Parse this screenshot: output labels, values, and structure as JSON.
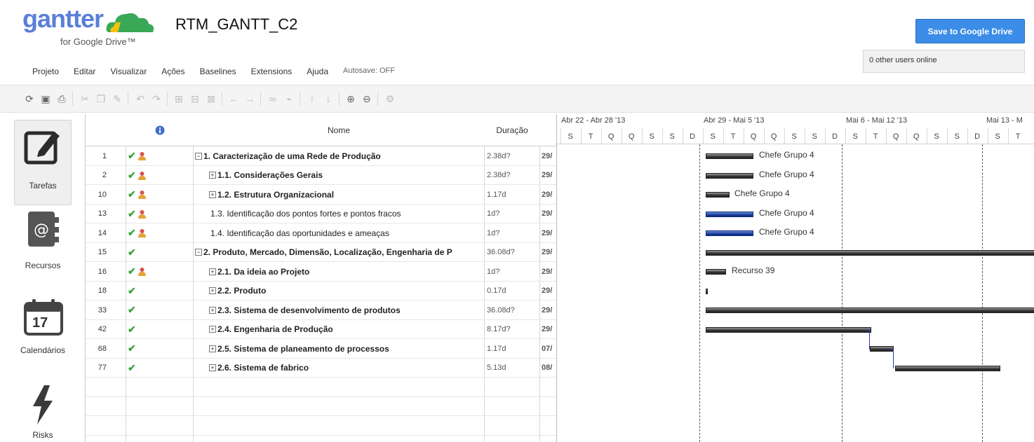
{
  "header": {
    "logo_word": "gantter",
    "logo_sub": "for Google Drive™",
    "doc_title": "RTM_GANTT_C2",
    "save_label": "Save to Google Drive",
    "users_online": "0 other users online"
  },
  "menu": {
    "items": [
      "Projeto",
      "Editar",
      "Visualizar",
      "Ações",
      "Baselines",
      "Extensions",
      "Ajuda"
    ],
    "autosave": "Autosave: OFF"
  },
  "sidebar": {
    "items": [
      {
        "label": "Tarefas",
        "icon": "edit-icon",
        "active": true
      },
      {
        "label": "Recursos",
        "icon": "address-book-icon",
        "active": false
      },
      {
        "label": "Calendários",
        "icon": "calendar-icon",
        "active": false,
        "calendar_day": "17"
      },
      {
        "label": "Risks",
        "icon": "lightning-icon",
        "active": false
      }
    ]
  },
  "grid": {
    "headers": {
      "name": "Nome",
      "duration": "Duração"
    },
    "rows": [
      {
        "id": "1",
        "check": true,
        "person": true,
        "expander": "−",
        "name": "1. Caracterização de uma Rede de Produção",
        "bold": true,
        "duration": "2.38d?",
        "start": "29/"
      },
      {
        "id": "2",
        "check": true,
        "person": true,
        "expander": "+",
        "name": "1.1. Considerações Gerais",
        "bold": true,
        "duration": "2.38d?",
        "start": "29/"
      },
      {
        "id": "10",
        "check": true,
        "person": true,
        "expander": "+",
        "name": "1.2. Estrutura Organizacional",
        "bold": true,
        "duration": "1.17d",
        "start": "29/"
      },
      {
        "id": "13",
        "check": true,
        "person": true,
        "expander": "",
        "name": "1.3. Identificação dos pontos fortes e pontos fracos",
        "bold": false,
        "duration": "1d?",
        "start": "29/"
      },
      {
        "id": "14",
        "check": true,
        "person": true,
        "expander": "",
        "name": "1.4. Identificação das oportunidades e ameaças",
        "bold": false,
        "duration": "1d?",
        "start": "29/"
      },
      {
        "id": "15",
        "check": true,
        "person": false,
        "expander": "−",
        "name": "2. Produto, Mercado, Dimensão, Localização, Engenharia de P",
        "bold": true,
        "duration": "36.08d?",
        "start": "29/"
      },
      {
        "id": "16",
        "check": true,
        "person": true,
        "expander": "+",
        "name": "2.1. Da ideia ao Projeto",
        "bold": true,
        "duration": "1d?",
        "start": "29/"
      },
      {
        "id": "18",
        "check": true,
        "person": false,
        "expander": "+",
        "name": "2.2. Produto",
        "bold": true,
        "duration": "0.17d",
        "start": "29/"
      },
      {
        "id": "33",
        "check": true,
        "person": false,
        "expander": "+",
        "name": "2.3.  Sistema de desenvolvimento de produtos",
        "bold": true,
        "duration": "36.08d?",
        "start": "29/"
      },
      {
        "id": "42",
        "check": true,
        "person": false,
        "expander": "+",
        "name": "2.4. Engenharia de Produção",
        "bold": true,
        "duration": "8.17d?",
        "start": "29/"
      },
      {
        "id": "68",
        "check": true,
        "person": false,
        "expander": "+",
        "name": "2.5.  Sistema de planeamento de processos",
        "bold": true,
        "duration": "1.17d",
        "start": "07/"
      },
      {
        "id": "77",
        "check": true,
        "person": false,
        "expander": "+",
        "name": "2.6.  Sistema de fabrico",
        "bold": true,
        "duration": "5.13d",
        "start": "08/"
      }
    ]
  },
  "gantt": {
    "weeks": [
      "Abr 22 - Abr 28 '13",
      "Abr 29 - Mai 5 '13",
      "Mai 6 - Mai 12 '13",
      "Mai 13 - M"
    ],
    "days": [
      "S",
      "T",
      "Q",
      "Q",
      "S",
      "S",
      "D",
      "S",
      "T",
      "Q",
      "Q",
      "S",
      "S",
      "D",
      "S",
      "T",
      "Q",
      "Q",
      "S",
      "S",
      "D",
      "S",
      "T"
    ],
    "labels": [
      "Chefe Grupo 4",
      "Chefe Grupo 4",
      "Chefe Grupo 4",
      "Chefe Grupo 4",
      "Chefe Grupo 4",
      "Recurso 39"
    ]
  },
  "colors": {
    "accent": "#3b8de8",
    "check": "#3aa43a",
    "bar_blue": "#1a3c9c",
    "bar_dark": "#333333"
  }
}
